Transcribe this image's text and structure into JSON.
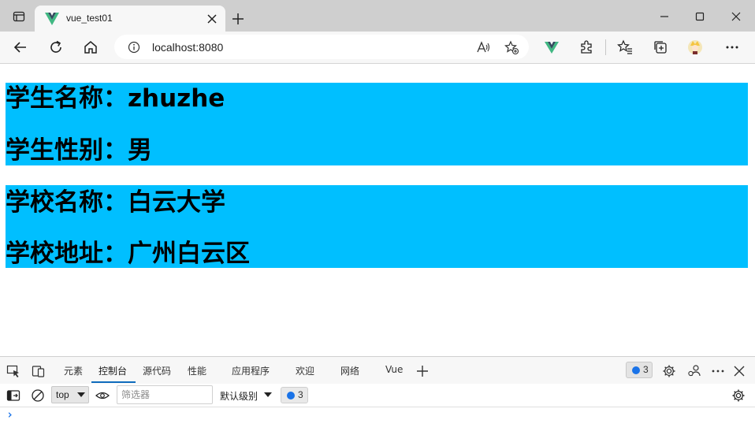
{
  "browser": {
    "tab": {
      "title": "vue_test01",
      "favicon": "vue-logo-icon"
    },
    "window_controls": [
      "minimize-icon",
      "maximize-icon",
      "close-icon"
    ],
    "address_bar": {
      "url": "localhost:8080"
    }
  },
  "page": {
    "student": {
      "name_label": "学生名称：zhuzhe",
      "gender_label": "学生性别：男"
    },
    "school": {
      "name_label": "学校名称：白云大学",
      "address_label": "学校地址：广州白云区"
    },
    "colors": {
      "card_background": "#00bfff",
      "text": "#000000"
    }
  },
  "devtools": {
    "tabs": [
      {
        "label": "元素"
      },
      {
        "label": "控制台",
        "active": true
      },
      {
        "label": "源代码"
      },
      {
        "label": "性能"
      },
      {
        "label": "应用程序"
      },
      {
        "label": "欢迎"
      },
      {
        "label": "网络"
      },
      {
        "label": "Vue"
      }
    ],
    "issues_count": "3",
    "console": {
      "context": "top",
      "filter_placeholder": "筛选器",
      "level": "默认级别",
      "issues_count": "3",
      "prompt": "›"
    }
  }
}
